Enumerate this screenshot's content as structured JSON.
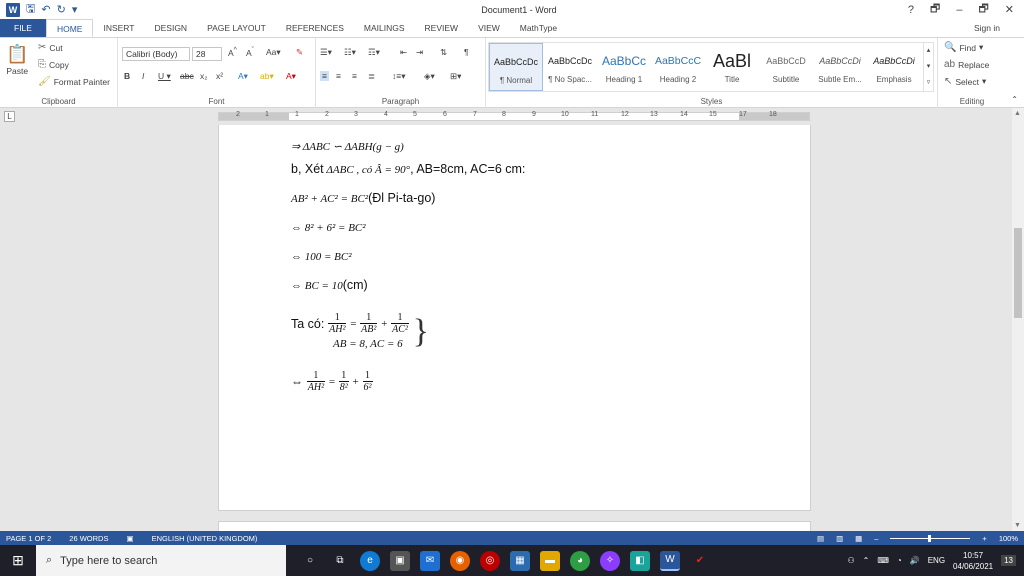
{
  "window": {
    "title": "Document1 - Word",
    "help": "?",
    "restore": "🗗",
    "minimize": "–",
    "maximize": "🗗",
    "close": "✕"
  },
  "tabs": [
    "FILE",
    "HOME",
    "INSERT",
    "DESIGN",
    "PAGE LAYOUT",
    "REFERENCES",
    "MAILINGS",
    "REVIEW",
    "VIEW",
    "MathType"
  ],
  "active_tab": "HOME",
  "signin": "Sign in",
  "clipboard": {
    "paste": "Paste",
    "cut": "Cut",
    "copy": "Copy",
    "format_painter": "Format Painter",
    "label": "Clipboard"
  },
  "font": {
    "name": "Calibri (Body)",
    "size": "28",
    "label": "Font"
  },
  "paragraph": {
    "label": "Paragraph"
  },
  "styles": {
    "label": "Styles",
    "items": [
      {
        "sample": "AaBbCcDc",
        "name": "¶ Normal"
      },
      {
        "sample": "AaBbCcDc",
        "name": "¶ No Spac..."
      },
      {
        "sample": "AaBbCc",
        "name": "Heading 1"
      },
      {
        "sample": "AaBbCcC",
        "name": "Heading 2"
      },
      {
        "sample": "AaBl",
        "name": "Title"
      },
      {
        "sample": "AaBbCcD",
        "name": "Subtitle"
      },
      {
        "sample": "AaBbCcDi",
        "name": "Subtle Em..."
      },
      {
        "sample": "AaBbCcDi",
        "name": "Emphasis"
      }
    ]
  },
  "editing": {
    "find": "Find",
    "replace": "Replace",
    "select": "Select",
    "label": "Editing"
  },
  "ruler_numbers": [
    "2",
    "1",
    "1",
    "2",
    "3",
    "4",
    "5",
    "6",
    "7",
    "8",
    "9",
    "10",
    "11",
    "12",
    "13",
    "14",
    "15",
    "17",
    "18"
  ],
  "document": {
    "line1": "⇒ ΔABC ∽ ΔABH(g − g)",
    "line2_prefix": "b, Xét",
    "line2_math": "ΔABC , có Â = 90°",
    "line2_suffix": ", AB=8cm, AC=6 cm:",
    "line3_math": "AB² + AC² = BC²",
    "line3_suffix": "(Đl Pi-ta-go)",
    "line4": "⇔ 8² + 6² = BC²",
    "line5": "⇔ 100 = BC²",
    "line6_math": "⇔ BC = 10",
    "line6_suffix": "(cm)",
    "line7_prefix": "Ta có:",
    "line7_num": "1",
    "line7_den1": "AH²",
    "line7_den2": "AB²",
    "line7_den3": "AC²",
    "line8": "AB = 8, AC = 6",
    "line9_den1": "AH²",
    "line9_den2": "8²",
    "line9_den3": "6²"
  },
  "status": {
    "page": "PAGE 1 OF 2",
    "words": "26 WORDS",
    "language": "ENGLISH (UNITED KINGDOM)",
    "zoom": "100%"
  },
  "taskbar": {
    "search_placeholder": "Type here to search",
    "lang": "ENG",
    "time": "10:57",
    "date": "04/06/2021",
    "notifications": "13"
  }
}
